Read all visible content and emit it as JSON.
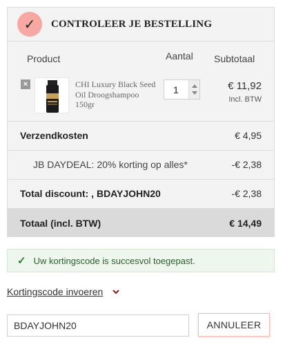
{
  "header": {
    "title": "CONTROLEER JE BESTELLING",
    "icon": "checkmark-icon"
  },
  "columns": {
    "product": "Product",
    "quantity": "Aantal",
    "subtotal": "Subtotaal"
  },
  "item": {
    "remove_label": "×",
    "name": "CHI Luxury Black Seed Oil Droogshampoo 150gr",
    "quantity": "1",
    "price": "€ 11,92",
    "vat_note": "Incl. BTW"
  },
  "summary": {
    "shipping_label": "Verzendkosten",
    "shipping_value": "€ 4,95",
    "deal_label": "JB DAYDEAL: 20% korting op alles*",
    "deal_value": "-€ 2,38",
    "discount_label": "Total discount: , BDAYJOHN20",
    "discount_value": "-€ 2,38",
    "total_label": "Totaal (incl. BTW)",
    "total_value": "€ 14,49"
  },
  "alert": {
    "message": "Uw kortingscode is succesvol toegepast."
  },
  "coupon": {
    "toggle_label": "Kortingscode invoeren",
    "input_value": "BDAYJOHN20",
    "cancel_label": "ANNULEER"
  },
  "colors": {
    "accent_circle": "#f7a8a3",
    "success_green": "#2e7d2e",
    "total_bg": "#dadada"
  }
}
